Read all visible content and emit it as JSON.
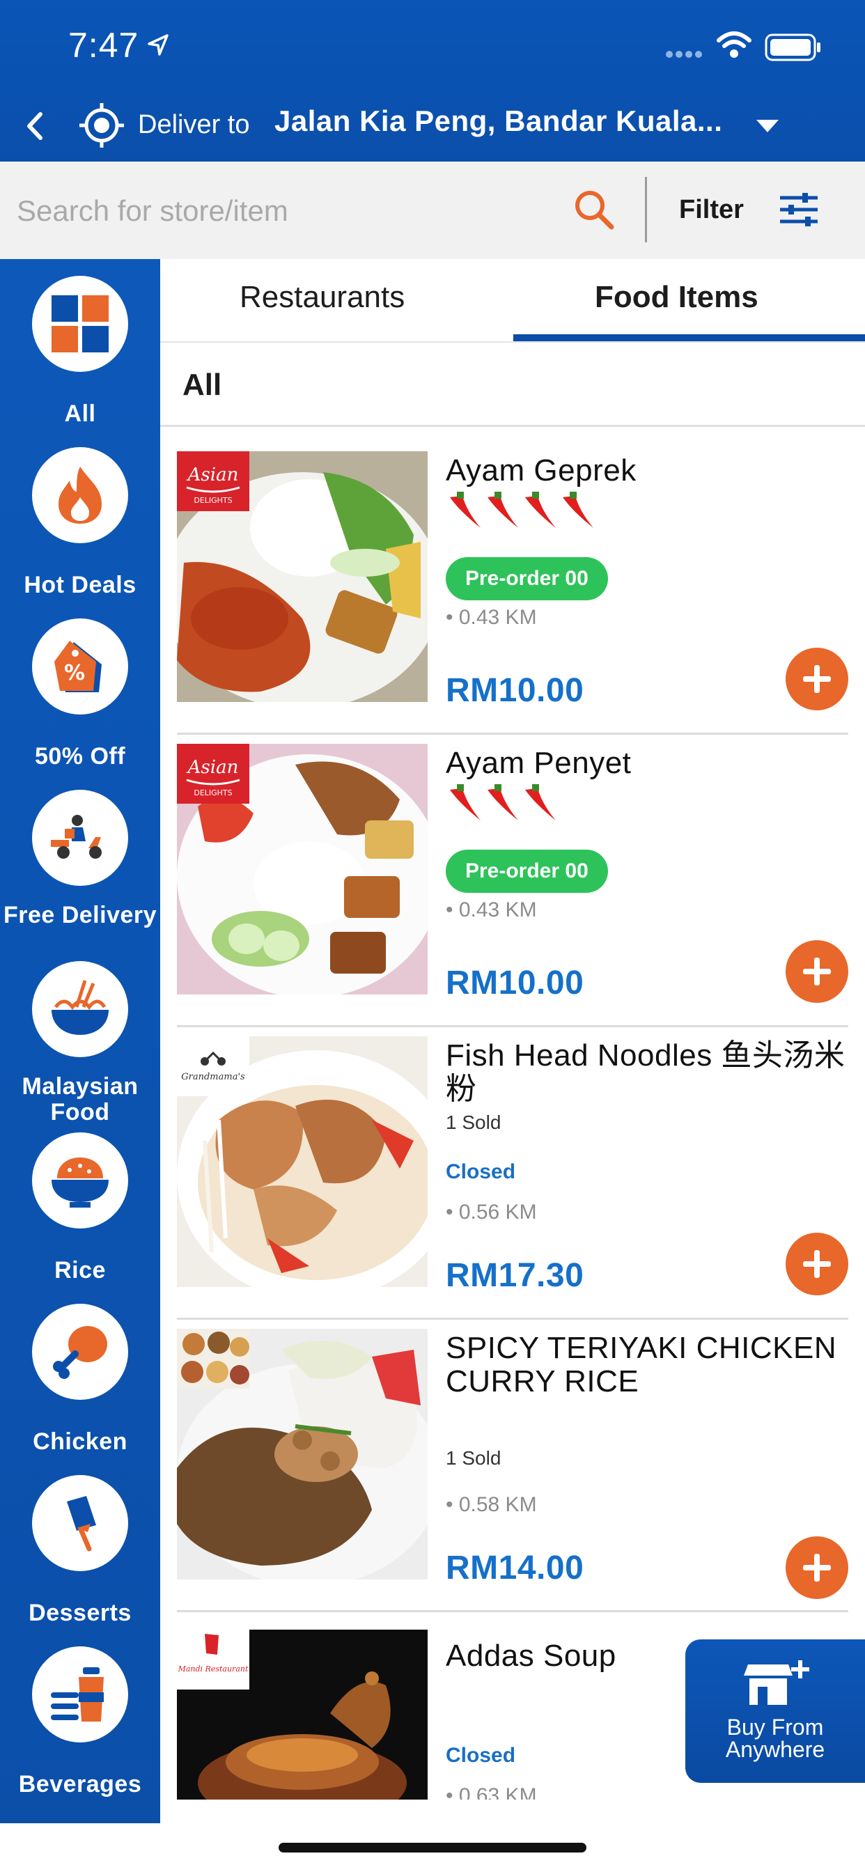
{
  "status_bar": {
    "time": "7:47"
  },
  "header": {
    "deliver_label": "Deliver to",
    "deliver_address": "Jalan Kia Peng, Bandar Kuala..."
  },
  "search": {
    "placeholder": "Search for store/item",
    "filter_label": "Filter"
  },
  "sidebar": {
    "categories": [
      {
        "label": "All",
        "icon": "grid-icon"
      },
      {
        "label": "Hot Deals",
        "icon": "flame-icon"
      },
      {
        "label": "50% Off",
        "icon": "discount-tag-icon"
      },
      {
        "label": "Free Delivery",
        "icon": "delivery-scooter-icon"
      },
      {
        "label": "Malaysian Food",
        "icon": "noodle-bowl-icon"
      },
      {
        "label": "Rice",
        "icon": "rice-bowl-icon"
      },
      {
        "label": "Chicken",
        "icon": "chicken-leg-icon"
      },
      {
        "label": "Desserts",
        "icon": "ice-cream-icon"
      },
      {
        "label": "Beverages",
        "icon": "beverage-icon"
      }
    ]
  },
  "tabs": {
    "restaurants": "Restaurants",
    "food_items": "Food Items",
    "active": "Food Items"
  },
  "section_title": "All",
  "items": [
    {
      "name": "Ayam Geprek",
      "chilis": 4,
      "badge": "Pre-order 00",
      "distance": "• 0.43 KM",
      "price": "RM10.00",
      "logo": "Asian DELIGHTS"
    },
    {
      "name": "Ayam Penyet",
      "chilis": 3,
      "badge": "Pre-order 00",
      "distance": "• 0.43 KM",
      "price": "RM10.00",
      "logo": "Asian DELIGHTS"
    },
    {
      "name": "Fish Head Noodles 鱼头汤米粉",
      "sold": "1 Sold",
      "status": "Closed",
      "distance": "• 0.56 KM",
      "price": "RM17.30",
      "logo": "Grandmama's"
    },
    {
      "name": "SPICY TERIYAKI CHICKEN CURRY RICE",
      "sold": "1 Sold",
      "distance": "• 0.58 KM",
      "price": "RM14.00"
    },
    {
      "name": "Addas Soup",
      "status": "Closed",
      "distance": "• 0.63 KM",
      "logo": "Mandi Restaurant"
    }
  ],
  "fab": {
    "label": "Buy From Anywhere",
    "icon": "store-plus-icon"
  },
  "colors": {
    "primary_blue": "#0b4fab",
    "accent_orange": "#e8672a",
    "price_blue": "#1570c9",
    "badge_green": "#2ec35a"
  }
}
